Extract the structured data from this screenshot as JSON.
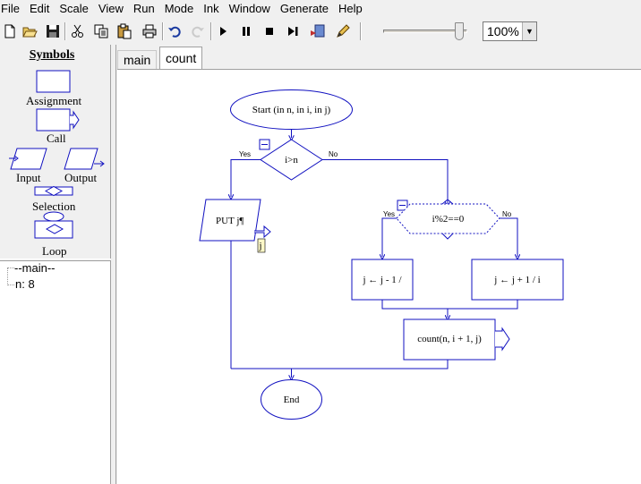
{
  "menu": [
    "File",
    "Edit",
    "Scale",
    "View",
    "Run",
    "Mode",
    "Ink",
    "Window",
    "Generate",
    "Help"
  ],
  "toolbar": {
    "buttons": [
      "new-icon",
      "open-icon",
      "save-icon",
      "cut-icon",
      "copy-icon",
      "paste-icon",
      "print-icon",
      "undo-icon",
      "redo-icon",
      "play-icon",
      "pause-icon",
      "stop-icon",
      "step-icon",
      "compile-icon",
      "ink-pen-icon"
    ],
    "zoom": "100%",
    "speed_level": 0.95
  },
  "symbols": {
    "title": "Symbols",
    "assignment": "Assignment",
    "call": "Call",
    "input": "Input",
    "output": "Output",
    "selection": "Selection",
    "loop": "Loop"
  },
  "variables": {
    "scope": "--main--",
    "item": "n: 8"
  },
  "tabs": [
    {
      "label": "main",
      "active": false
    },
    {
      "label": "count",
      "active": true
    }
  ],
  "flowchart": {
    "colors": {
      "stroke": "#1010c0",
      "comment": "#fdf8c8"
    },
    "start": "Start (in n, in i, in j)",
    "cond1": "i>n",
    "yes": "Yes",
    "no": "No",
    "output": "PUT j¶",
    "output_comment": "j",
    "cond2": "i%2==0",
    "assign_left": "j ← j - 1 /",
    "assign_right": "j ← j + 1 / i",
    "call": "count(n,  i + 1,  j)",
    "end": "End"
  }
}
